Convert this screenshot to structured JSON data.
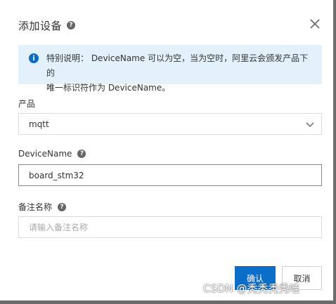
{
  "dialog": {
    "title": "添加设备",
    "help_icon": "?",
    "close_icon": "close-icon"
  },
  "notice": {
    "line1": "特别说明： DeviceName 可以为空，当为空时，阿里云会颁发产品下的",
    "line2": "唯一标识符作为 DeviceName。",
    "icon": "i"
  },
  "product": {
    "label": "产品",
    "value": "mqtt"
  },
  "device_name": {
    "label": "DeviceName",
    "value": "board_stm32"
  },
  "remark": {
    "label": "备注名称",
    "placeholder": "请输入备注名称"
  },
  "buttons": {
    "confirm": "确认",
    "cancel": "取消"
  },
  "watermark": "CSDN @秃秃秃秃哇",
  "colors": {
    "primary": "#0a6ec8",
    "notice_bg": "#e3f1fb"
  }
}
